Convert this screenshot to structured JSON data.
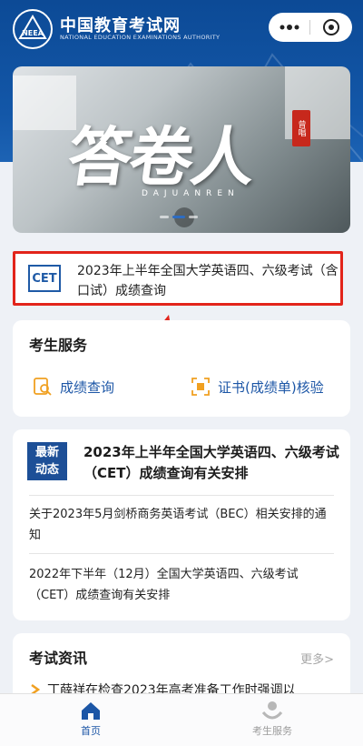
{
  "header": {
    "brand_cn": "中国教育考试网",
    "brand_en": "NATIONAL EDUCATION EXAMINATIONS AUTHORITY",
    "logo_text": "NEEA",
    "capsule": {
      "more_icon": "more-dots-icon",
      "close_icon": "target-circle-icon"
    }
  },
  "banner": {
    "title": "答卷人",
    "subtitle": "DAJUANREN",
    "seal": "曾唱",
    "slides": 3,
    "active_slide": 2
  },
  "notice": {
    "logo": "CET",
    "text": "2023年上半年全国大学英语四、六级考试（含口试）成绩查询"
  },
  "services": {
    "title": "考生服务",
    "items": [
      {
        "label": "成绩查询",
        "icon": "score-search-icon"
      },
      {
        "label": "证书(成绩单)核验",
        "icon": "certificate-verify-icon"
      }
    ]
  },
  "news": {
    "badge_line1": "最新",
    "badge_line2": "动态",
    "headline": "2023年上半年全国大学英语四、六级考试（CET）成绩查询有关安排",
    "items": [
      "关于2023年5月剑桥商务英语考试（BEC）相关安排的通知",
      "2022年下半年（12月）全国大学英语四、六级考试（CET）成绩查询有关安排"
    ]
  },
  "info": {
    "title": "考试资讯",
    "more": "更多>",
    "items": [
      "丁薛祥在检查2023年高考准备工作时强调以"
    ]
  },
  "tabbar": {
    "tabs": [
      {
        "label": "首页",
        "icon": "home-icon",
        "active": true
      },
      {
        "label": "考生服务",
        "icon": "service-heart-icon",
        "active": false
      }
    ]
  },
  "colors": {
    "brand_blue": "#0c4a96",
    "highlight_red": "#e2241b",
    "link_blue": "#1c56a6",
    "accent_orange": "#f0a021"
  }
}
